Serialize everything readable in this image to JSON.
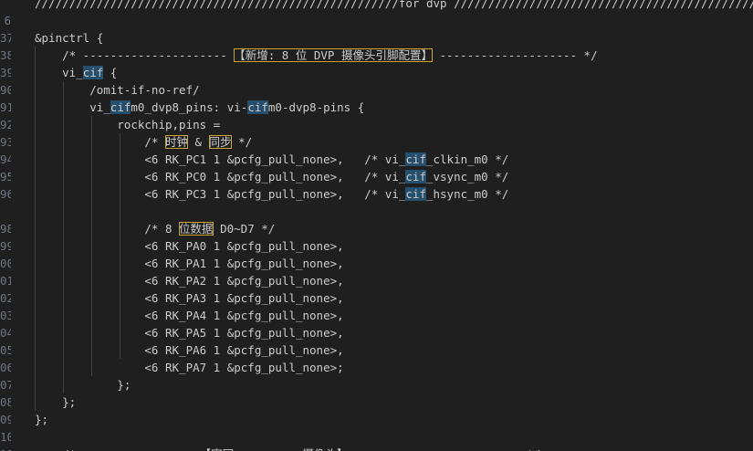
{
  "editor": {
    "line_numbers": [
      "",
      "6",
      "37",
      "38",
      "39",
      "90",
      "91",
      "92",
      "93",
      "94",
      "95",
      "96",
      "",
      "98",
      "99",
      "00",
      "01",
      "02",
      "03",
      "04",
      "05",
      "06",
      "07",
      "08",
      "09",
      "10",
      "11"
    ],
    "lines": [
      {
        "id": "l0",
        "tokens": [
          {
            "t": "/////////////////////////////////////////////////////for dvp //////////////////////////////////////////////"
          }
        ]
      },
      {
        "id": "l1",
        "tokens": []
      },
      {
        "id": "l2",
        "tokens": [
          {
            "t": "&pinctrl {"
          }
        ]
      },
      {
        "id": "l3",
        "tokens": [
          {
            "t": "    /* --------------------- "
          },
          {
            "t": "【新增: 8 位 DVP 摄像头引脚配置】",
            "style": "box"
          },
          {
            "t": " -------------------- */"
          }
        ]
      },
      {
        "id": "l4",
        "tokens": [
          {
            "t": "    vi_"
          },
          {
            "t": "cif",
            "style": "hl"
          },
          {
            "t": " {"
          }
        ]
      },
      {
        "id": "l5",
        "tokens": [
          {
            "t": "        /omit-if-no-ref/"
          }
        ]
      },
      {
        "id": "l6",
        "tokens": [
          {
            "t": "        vi_"
          },
          {
            "t": "cif",
            "style": "hl"
          },
          {
            "t": "m0_dvp8_pins: vi-"
          },
          {
            "t": "cif",
            "style": "hl"
          },
          {
            "t": "m0-dvp8-pins {"
          }
        ]
      },
      {
        "id": "l7",
        "tokens": [
          {
            "t": "            rockchip,pins ="
          }
        ]
      },
      {
        "id": "l8",
        "tokens": [
          {
            "t": "                /* "
          },
          {
            "t": "时钟",
            "style": "box"
          },
          {
            "t": " & "
          },
          {
            "t": "同步",
            "style": "box"
          },
          {
            "t": " */"
          }
        ]
      },
      {
        "id": "l9",
        "tokens": [
          {
            "t": "                <6 RK_PC1 1 &pcfg_pull_none>,   /* vi_"
          },
          {
            "t": "cif",
            "style": "hl"
          },
          {
            "t": "_clkin_m0 */"
          }
        ]
      },
      {
        "id": "l10",
        "tokens": [
          {
            "t": "                <6 RK_PC0 1 &pcfg_pull_none>,   /* vi_"
          },
          {
            "t": "cif",
            "style": "hl"
          },
          {
            "t": "_vsync_m0 */"
          }
        ]
      },
      {
        "id": "l11",
        "tokens": [
          {
            "t": "                <6 RK_PC3 1 &pcfg_pull_none>,   /* vi_"
          },
          {
            "t": "cif",
            "style": "hl"
          },
          {
            "t": "_hsync_m0 */"
          }
        ]
      },
      {
        "id": "l12",
        "tokens": []
      },
      {
        "id": "l13",
        "tokens": [
          {
            "t": "                /* 8 "
          },
          {
            "t": "位数据",
            "style": "box"
          },
          {
            "t": " D0~D7 */"
          }
        ]
      },
      {
        "id": "l14",
        "tokens": [
          {
            "t": "                <6 RK_PA0 1 &pcfg_pull_none>,"
          }
        ]
      },
      {
        "id": "l15",
        "tokens": [
          {
            "t": "                <6 RK_PA1 1 &pcfg_pull_none>,"
          }
        ]
      },
      {
        "id": "l16",
        "tokens": [
          {
            "t": "                <6 RK_PA2 1 &pcfg_pull_none>,"
          }
        ]
      },
      {
        "id": "l17",
        "tokens": [
          {
            "t": "                <6 RK_PA3 1 &pcfg_pull_none>,"
          }
        ]
      },
      {
        "id": "l18",
        "tokens": [
          {
            "t": "                <6 RK_PA4 1 &pcfg_pull_none>,"
          }
        ]
      },
      {
        "id": "l19",
        "tokens": [
          {
            "t": "                <6 RK_PA5 1 &pcfg_pull_none>,"
          }
        ]
      },
      {
        "id": "l20",
        "tokens": [
          {
            "t": "                <6 RK_PA6 1 &pcfg_pull_none>,"
          }
        ]
      },
      {
        "id": "l21",
        "tokens": [
          {
            "t": "                <6 RK_PA7 1 &pcfg_pull_none>;"
          }
        ]
      },
      {
        "id": "l22",
        "tokens": [
          {
            "t": "            };"
          }
        ]
      },
      {
        "id": "l23",
        "tokens": [
          {
            "t": "    };"
          }
        ]
      },
      {
        "id": "l24",
        "tokens": [
          {
            "t": "};"
          }
        ]
      },
      {
        "id": "l25",
        "tokens": []
      },
      {
        "id": "l26",
        "tokens": [
          {
            "t": "    /*                  【官网          摄像头】                          */"
          }
        ]
      }
    ]
  },
  "colors": {
    "background": "#1f1f1f",
    "text": "#cccccc",
    "line_number": "#6e7681",
    "selection_highlight": "#264f6e",
    "find_box_border": "#c7a535",
    "indent_guide": "#404040"
  }
}
